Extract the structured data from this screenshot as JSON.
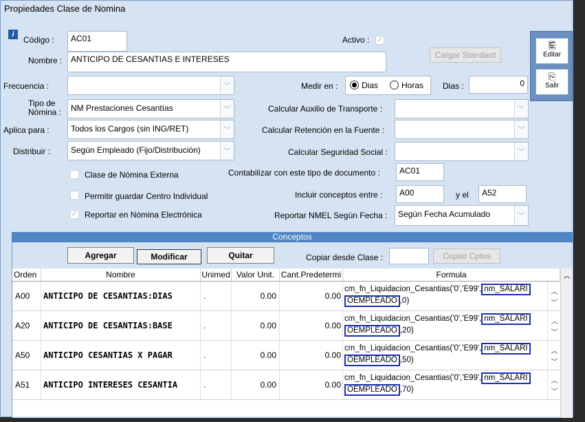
{
  "window": {
    "title": "Propiedades Clase de Nomina"
  },
  "form": {
    "codigo_label": "Código :",
    "codigo_value": "AC01",
    "activo_label": "Activo :",
    "activo_checked": true,
    "nombre_label": "Nombre :",
    "nombre_value": "ANTICIPO DE CESANTIAS E INTERESES",
    "cargar_standard": "Cargar Standard",
    "frecuencia_label": "Frecuencia :",
    "frecuencia_value": "",
    "medir_label": "Medir en :",
    "medir_options": [
      "Dias",
      "Horas"
    ],
    "medir_selected": "Dias",
    "dias_label": "Dias :",
    "dias_value": "0",
    "tipo_label_1": "Tipo de",
    "tipo_label_2": "Nómina :",
    "tipo_value": "NM Prestaciones Cesantías",
    "aux_transporte_label": "Calcular Auxilio de Transporte :",
    "aux_transporte_value": "",
    "aplica_label": "Aplica para :",
    "aplica_value": "Todos los Cargos (sin ING/RET)",
    "retencion_label": "Calcular Retención en la Fuente :",
    "retencion_value": "",
    "distribuir_label": "Distribuir :",
    "distribuir_value": "Según Empleado (Fijo/Distribución)",
    "seg_social_label": "Calcular Seguridad Social :",
    "seg_social_value": "",
    "externa_label": "Clase de Nómina Externa",
    "externa_checked": false,
    "centro_label": "Permitir guardar Centro Individual",
    "centro_checked": false,
    "electronica_label": "Reportar en Nómina Electrónica",
    "electronica_checked": true,
    "contabilizar_label": "Contabilizar con este tipo de documento :",
    "contabilizar_value": "AC01",
    "incluir_label": "Incluir conceptos entre :",
    "incluir_from": "A00",
    "incluir_and_label": "y el",
    "incluir_to": "A52",
    "nmel_label": "Reportar NMEL Según Fecha :",
    "nmel_value": "Según Fecha Acumulado"
  },
  "side": {
    "editar": "Editar",
    "salir": "Salir"
  },
  "conceptos": {
    "band_title": "Conceptos",
    "agregar": "Agregar",
    "modificar": "Modificar",
    "quitar": "Quitar",
    "copiar_label": "Copiar desde Clase :",
    "copiar_value": "",
    "copiar_btn": "Copiar Cptos",
    "columns": [
      "Orden",
      "Nombre",
      "Unimed",
      "Valor Unit.",
      "Cant.Predetermi",
      "Formula"
    ],
    "rows": [
      {
        "orden": "A00",
        "nombre": "ANTICIPO DE CESANTIAS:DIAS",
        "unimed": ".",
        "valor": "0.00",
        "cant": "0.00",
        "f1": "cm_fn_Liquidacion_Cesantias('0','E99',",
        "f1b": "nm_SALARI",
        "f2a": "OEMPLEADO",
        "f2b": ",0)"
      },
      {
        "orden": "A20",
        "nombre": "ANTICIPO DE CESANTIAS:BASE",
        "unimed": ".",
        "valor": "0.00",
        "cant": "0.00",
        "f1": "cm_fn_Liquidacion_Cesantias('0','E99',",
        "f1b": "nm_SALARI",
        "f2a": "OEMPLEADO",
        "f2b": ",20)"
      },
      {
        "orden": "A50",
        "nombre": "ANTICIPO CESANTIAS X PAGAR",
        "unimed": ".",
        "valor": "0.00",
        "cant": "0.00",
        "f1": "cm_fn_Liquidacion_Cesantias('0','E99',",
        "f1b": "nm_SALARI",
        "f2a": "OEMPLEADO",
        "f2b": ",50)"
      },
      {
        "orden": "A51",
        "nombre": "ANTICIPO INTERESES CESANTIA",
        "unimed": ".",
        "valor": "0.00",
        "cant": "0.00",
        "f1": "cm_fn_Liquidacion_Cesantias('0','E99',",
        "f1b": "nm_SALARI",
        "f2a": "OEMPLEADO",
        "f2b": ",70)"
      }
    ]
  }
}
